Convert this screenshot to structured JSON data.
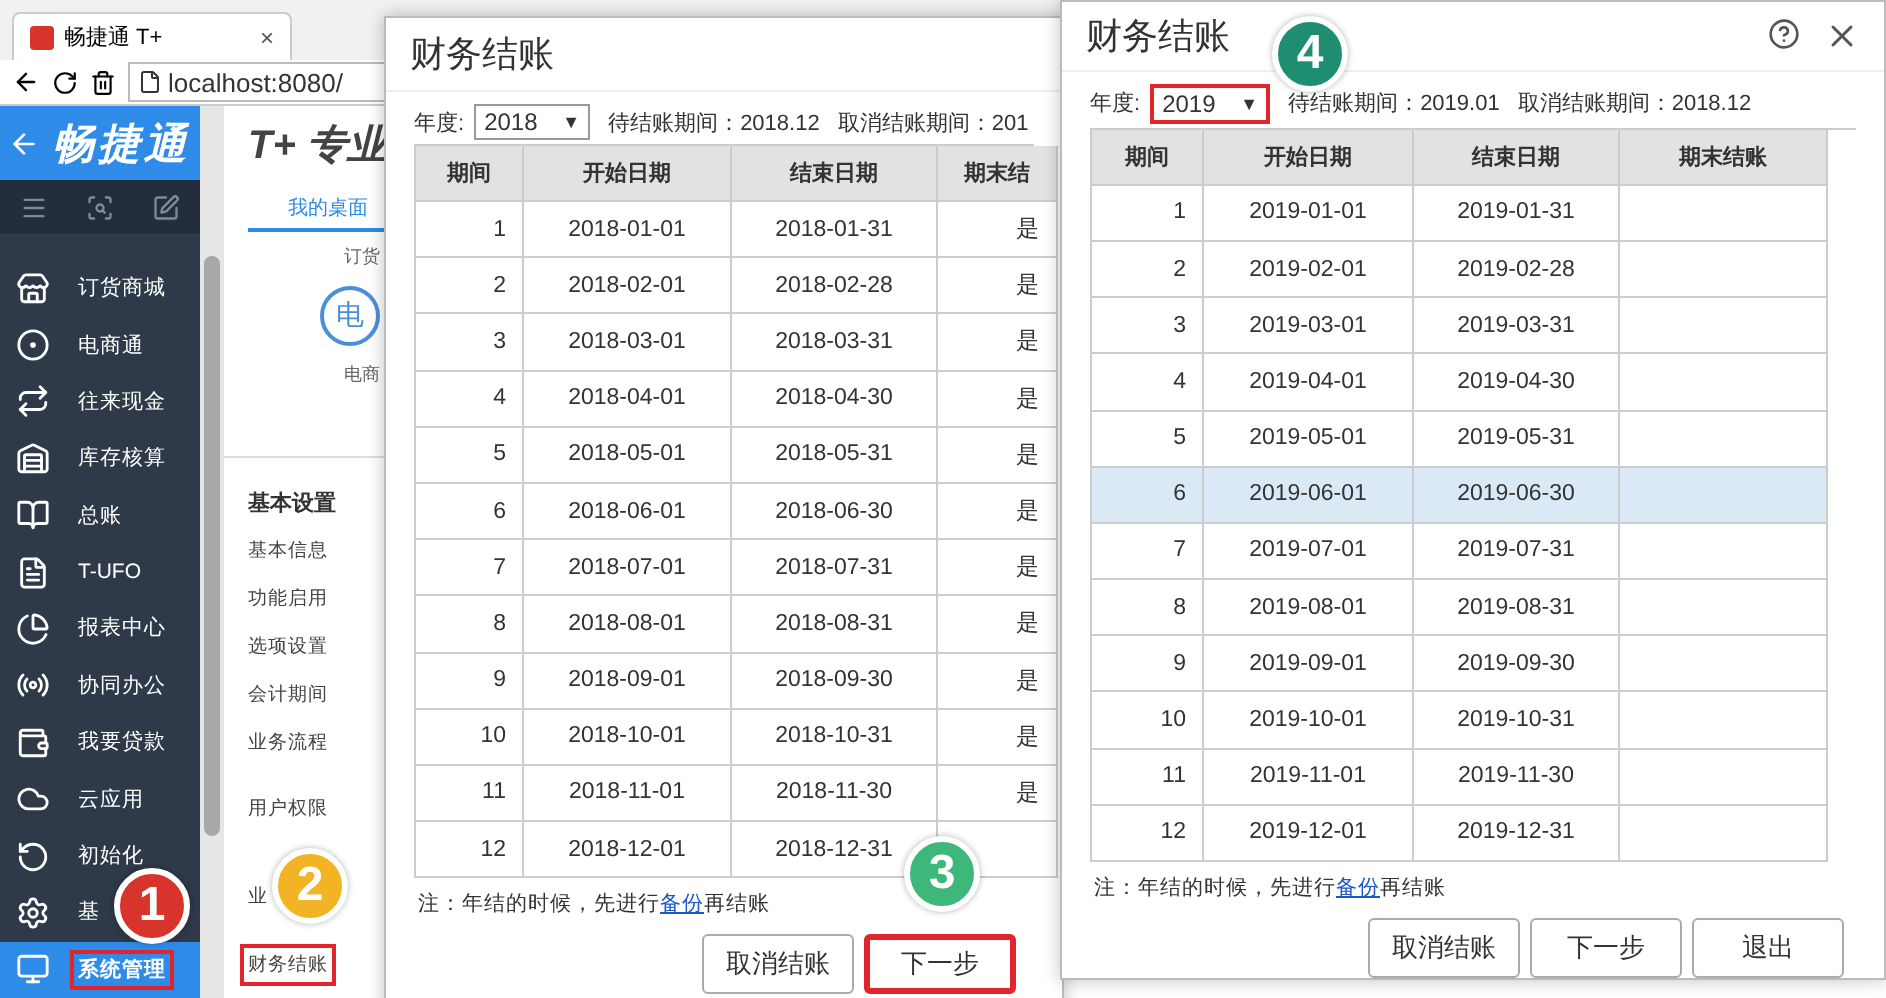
{
  "browser": {
    "tab_title": "畅捷通 T+",
    "tab_close": "×",
    "address": "localhost:8080/"
  },
  "app": {
    "logo": "畅捷通",
    "product_title": "T+ 专业",
    "desk_tab": "我的桌面",
    "desk_label": "订货",
    "desk_icon_text": "电",
    "desk_icon_label": "电商",
    "sidebar_items": [
      {
        "label": "订货商城",
        "selected": false,
        "highlighted": false
      },
      {
        "label": "电商通",
        "selected": false,
        "highlighted": false
      },
      {
        "label": "往来现金",
        "selected": false,
        "highlighted": false
      },
      {
        "label": "库存核算",
        "selected": false,
        "highlighted": false
      },
      {
        "label": "总账",
        "selected": false,
        "highlighted": false
      },
      {
        "label": "T-UFO",
        "selected": false,
        "highlighted": false
      },
      {
        "label": "报表中心",
        "selected": false,
        "highlighted": false
      },
      {
        "label": "协同办公",
        "selected": false,
        "highlighted": false
      },
      {
        "label": "我要贷款",
        "selected": false,
        "highlighted": false
      },
      {
        "label": "云应用",
        "selected": false,
        "highlighted": false
      },
      {
        "label": "初始化",
        "selected": false,
        "highlighted": false
      },
      {
        "label": "基",
        "selected": false,
        "highlighted": false
      },
      {
        "label": "系统管理",
        "selected": true,
        "highlighted": true
      }
    ],
    "settings_heading": "基本设置",
    "settings_items": [
      {
        "label": "基本信息",
        "highlighted": false
      },
      {
        "label": "功能启用",
        "highlighted": false
      },
      {
        "label": "选项设置",
        "highlighted": false
      },
      {
        "label": "会计期间",
        "highlighted": false
      },
      {
        "label": "业务流程",
        "highlighted": false
      },
      {
        "label": "用户权限",
        "highlighted": false
      },
      {
        "label": "业",
        "highlighted": false
      },
      {
        "label": "财务结账",
        "highlighted": true
      }
    ]
  },
  "dialogs": [
    {
      "title": "财务结账",
      "year_label": "年度:",
      "year": "2018",
      "year_arrow": "▼",
      "year_highlighted": false,
      "pending": "待结账期间：2018.12",
      "cancel": "取消结账期间：201",
      "columns": [
        "期间",
        "开始日期",
        "结束日期",
        "期末结"
      ],
      "rows": [
        {
          "period": "1",
          "start": "2018-01-01",
          "end": "2018-01-31",
          "closed": "是",
          "selected": false
        },
        {
          "period": "2",
          "start": "2018-02-01",
          "end": "2018-02-28",
          "closed": "是",
          "selected": false
        },
        {
          "period": "3",
          "start": "2018-03-01",
          "end": "2018-03-31",
          "closed": "是",
          "selected": false
        },
        {
          "period": "4",
          "start": "2018-04-01",
          "end": "2018-04-30",
          "closed": "是",
          "selected": false
        },
        {
          "period": "5",
          "start": "2018-05-01",
          "end": "2018-05-31",
          "closed": "是",
          "selected": false
        },
        {
          "period": "6",
          "start": "2018-06-01",
          "end": "2018-06-30",
          "closed": "是",
          "selected": false
        },
        {
          "period": "7",
          "start": "2018-07-01",
          "end": "2018-07-31",
          "closed": "是",
          "selected": false
        },
        {
          "period": "8",
          "start": "2018-08-01",
          "end": "2018-08-31",
          "closed": "是",
          "selected": false
        },
        {
          "period": "9",
          "start": "2018-09-01",
          "end": "2018-09-30",
          "closed": "是",
          "selected": false
        },
        {
          "period": "10",
          "start": "2018-10-01",
          "end": "2018-10-31",
          "closed": "是",
          "selected": false
        },
        {
          "period": "11",
          "start": "2018-11-01",
          "end": "2018-11-30",
          "closed": "是",
          "selected": false
        },
        {
          "period": "12",
          "start": "2018-12-01",
          "end": "2018-12-31",
          "selected": false
        }
      ],
      "note_before": "注：年结的时候，先进行",
      "note_link": "备份",
      "note_after": "再结账",
      "buttons": [
        {
          "label": "取消结账",
          "highlighted": false
        },
        {
          "label": "下一步",
          "highlighted": true
        }
      ]
    },
    {
      "title": "财务结账",
      "window_controls": true,
      "year_label": "年度:",
      "year": "2019",
      "year_arrow": "▼",
      "year_highlighted": true,
      "pending": "待结账期间：2019.01",
      "cancel": "取消结账期间：2018.12",
      "columns": [
        "期间",
        "开始日期",
        "结束日期",
        "期末结账"
      ],
      "rows": [
        {
          "period": "1",
          "start": "2019-01-01",
          "end": "2019-01-31",
          "selected": false
        },
        {
          "period": "2",
          "start": "2019-02-01",
          "end": "2019-02-28",
          "selected": false
        },
        {
          "period": "3",
          "start": "2019-03-01",
          "end": "2019-03-31",
          "selected": false
        },
        {
          "period": "4",
          "start": "2019-04-01",
          "end": "2019-04-30",
          "selected": false
        },
        {
          "period": "5",
          "start": "2019-05-01",
          "end": "2019-05-31",
          "selected": false
        },
        {
          "period": "6",
          "start": "2019-06-01",
          "end": "2019-06-30",
          "selected": true
        },
        {
          "period": "7",
          "start": "2019-07-01",
          "end": "2019-07-31",
          "selected": false
        },
        {
          "period": "8",
          "start": "2019-08-01",
          "end": "2019-08-31",
          "selected": false
        },
        {
          "period": "9",
          "start": "2019-09-01",
          "end": "2019-09-30",
          "selected": false
        },
        {
          "period": "10",
          "start": "2019-10-01",
          "end": "2019-10-31",
          "selected": false
        },
        {
          "period": "11",
          "start": "2019-11-01",
          "end": "2019-11-30",
          "selected": false
        },
        {
          "period": "12",
          "start": "2019-12-01",
          "end": "2019-12-31",
          "selected": false
        }
      ],
      "note_before": "注：年结的时候，先进行",
      "note_link": "备份",
      "note_after": "再结账",
      "buttons": [
        {
          "label": "取消结账",
          "highlighted": false
        },
        {
          "label": "下一步",
          "highlighted": false
        },
        {
          "label": "退出",
          "highlighted": false
        }
      ]
    }
  ],
  "badges": [
    {
      "number": "1",
      "color": "#d8342c"
    },
    {
      "number": "2",
      "color": "#f2b425"
    },
    {
      "number": "3",
      "color": "#3db77a"
    },
    {
      "number": "4",
      "color": "#1f8e70"
    }
  ]
}
